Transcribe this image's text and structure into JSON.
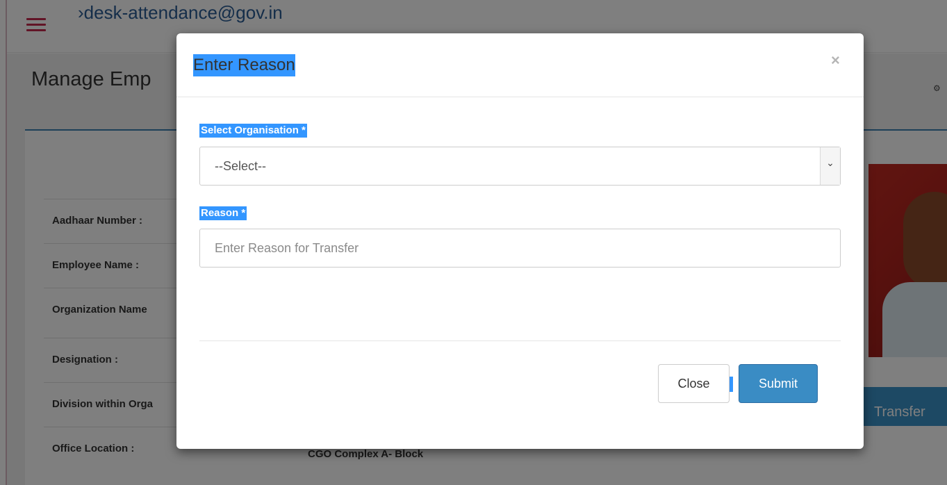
{
  "header": {
    "email": "›desk-attendance@gov.in"
  },
  "page": {
    "title": "Manage Emp",
    "dashboard_icon": "dashboard-icon"
  },
  "details": {
    "rows": [
      {
        "label": "Aadhaar Number :",
        "value": ""
      },
      {
        "label": "Employee Name :",
        "value": ""
      },
      {
        "label": "Organization Name",
        "value": ""
      },
      {
        "label": "Designation :",
        "value": ""
      },
      {
        "label": "Division within Orga",
        "value": ""
      },
      {
        "label": "Office Location :",
        "value": "CGO Complex A- Block"
      }
    ]
  },
  "transfer_button": {
    "label": "Transfer"
  },
  "modal": {
    "title": "Enter Reason",
    "close_symbol": "×",
    "organisation": {
      "label": "Select Organisation *",
      "selected": "--Select--"
    },
    "reason": {
      "label": "Reason *",
      "placeholder": "Enter Reason for Transfer",
      "value": ""
    },
    "buttons": {
      "close_label": "Close",
      "submit_label": "Submit"
    }
  },
  "colors": {
    "accent": "#3a8cc4",
    "brand_hamburger": "#c4284d",
    "text_selection": "#3396ff"
  }
}
